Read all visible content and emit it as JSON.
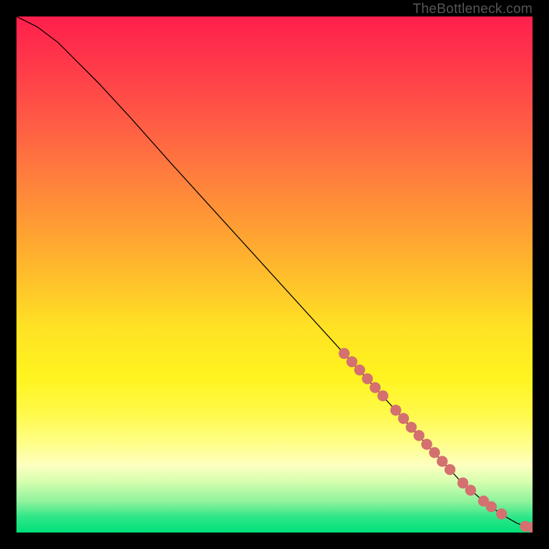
{
  "attribution": "TheBottleneck.com",
  "chart_data": {
    "type": "line",
    "xlim": [
      0,
      100
    ],
    "ylim": [
      0,
      100
    ],
    "grid": false,
    "legend": false,
    "title": "",
    "xlabel": "",
    "ylabel": "",
    "line": {
      "color": "#000000",
      "stroke_width": 1.3,
      "points": [
        {
          "x": 0,
          "y": 100
        },
        {
          "x": 4,
          "y": 98
        },
        {
          "x": 8,
          "y": 95
        },
        {
          "x": 12,
          "y": 91
        },
        {
          "x": 16,
          "y": 87
        },
        {
          "x": 22,
          "y": 80.5
        },
        {
          "x": 30,
          "y": 71.5
        },
        {
          "x": 40,
          "y": 60.5
        },
        {
          "x": 50,
          "y": 49.5
        },
        {
          "x": 60,
          "y": 38.5
        },
        {
          "x": 70,
          "y": 27.5
        },
        {
          "x": 80,
          "y": 16.5
        },
        {
          "x": 86,
          "y": 10
        },
        {
          "x": 90,
          "y": 6.5
        },
        {
          "x": 94,
          "y": 3.5
        },
        {
          "x": 97,
          "y": 1.8
        },
        {
          "x": 99.2,
          "y": 1.0
        },
        {
          "x": 100,
          "y": 1.0
        }
      ]
    },
    "markers": {
      "color": "#d47070",
      "radius": 8,
      "points": [
        {
          "x": 63.5,
          "y": 34.7
        },
        {
          "x": 65.0,
          "y": 33.1
        },
        {
          "x": 66.5,
          "y": 31.5
        },
        {
          "x": 68.0,
          "y": 29.8
        },
        {
          "x": 69.5,
          "y": 28.1
        },
        {
          "x": 71.0,
          "y": 26.5
        },
        {
          "x": 73.5,
          "y": 23.7
        },
        {
          "x": 75.0,
          "y": 22.1
        },
        {
          "x": 76.5,
          "y": 20.4
        },
        {
          "x": 78.0,
          "y": 18.8
        },
        {
          "x": 79.5,
          "y": 17.1
        },
        {
          "x": 81.0,
          "y": 15.5
        },
        {
          "x": 82.5,
          "y": 13.8
        },
        {
          "x": 84.0,
          "y": 12.2
        },
        {
          "x": 86.5,
          "y": 9.6
        },
        {
          "x": 88.0,
          "y": 8.2
        },
        {
          "x": 90.5,
          "y": 6.1
        },
        {
          "x": 92.0,
          "y": 5.0
        },
        {
          "x": 94.0,
          "y": 3.6
        },
        {
          "x": 98.6,
          "y": 1.2
        },
        {
          "x": 100.0,
          "y": 1.0
        }
      ]
    }
  }
}
